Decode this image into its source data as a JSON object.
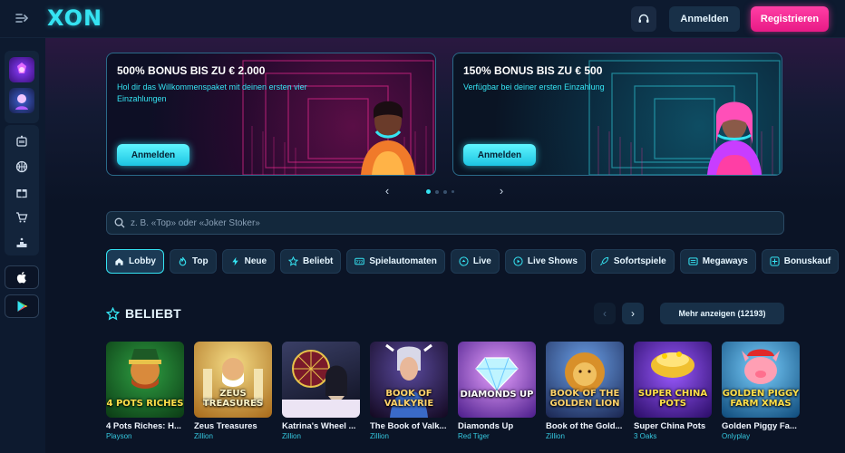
{
  "header": {
    "logo_text": "XON",
    "login_label": "Anmelden",
    "register_label": "Registrieren"
  },
  "banners": [
    {
      "title": "500% BONUS BIS ZU € 2.000",
      "text": "Hol dir das Willkommenspaket mit deinen ersten vier Einzahlungen",
      "button": "Anmelden",
      "accent": "#ff2e9a"
    },
    {
      "title": "150% BONUS BIS ZU € 500",
      "text": "Verfügbar bei deiner ersten Einzahlung",
      "button": "Anmelden",
      "accent": "#35e3f2"
    }
  ],
  "carousel": {
    "prev": "‹",
    "next": "›"
  },
  "search": {
    "placeholder": "z. B. «Top» oder «Joker Stoker»"
  },
  "categories": [
    {
      "label": "Lobby",
      "icon": "home-icon",
      "active": true
    },
    {
      "label": "Top",
      "icon": "flame-icon"
    },
    {
      "label": "Neue",
      "icon": "bolt-icon"
    },
    {
      "label": "Beliebt",
      "icon": "star-icon"
    },
    {
      "label": "Spielautomaten",
      "icon": "slot-777-icon"
    },
    {
      "label": "Live",
      "icon": "live-icon"
    },
    {
      "label": "Live Shows",
      "icon": "play-icon"
    },
    {
      "label": "Sofortspiele",
      "icon": "rocket-icon"
    },
    {
      "label": "Megaways",
      "icon": "megaways-icon"
    },
    {
      "label": "Bonuskauf",
      "icon": "bonus-buy-icon"
    }
  ],
  "section": {
    "title": "BELIEBT",
    "more_label": "Mehr anzeigen (12193)",
    "prev": "‹",
    "next": "›"
  },
  "games": [
    {
      "name": "4 Pots Riches: H...",
      "provider": "Playson",
      "thumb_text": "4 POTS RICHES",
      "color_a": "#1f7a2e",
      "color_b": "#0b3a14"
    },
    {
      "name": "Zeus Treasures",
      "provider": "Zillion",
      "thumb_text": "ZEUS TREASURES",
      "color_a": "#e0b34a",
      "color_b": "#7a4e12"
    },
    {
      "name": "Katrina's Wheel ...",
      "provider": "Zillion",
      "thumb_text": "",
      "color_a": "#2a2f4e",
      "color_b": "#0d0f1e"
    },
    {
      "name": "The Book of Valk...",
      "provider": "Zillion",
      "thumb_text": "BOOK OF VALKYRIE",
      "color_a": "#3a2a5e",
      "color_b": "#12081f"
    },
    {
      "name": "Diamonds Up",
      "provider": "Red Tiger",
      "thumb_text": "DIAMONDS UP",
      "color_a": "#d06fe8",
      "color_b": "#4a1c8a"
    },
    {
      "name": "Book of the Gold...",
      "provider": "Zillion",
      "thumb_text": "BOOK OF THE GOLDEN LION",
      "color_a": "#3f6ec4",
      "color_b": "#1a2550"
    },
    {
      "name": "Super China Pots",
      "provider": "3 Oaks",
      "thumb_text": "SUPER CHINA POTS",
      "color_a": "#6a2ad0",
      "color_b": "#2a0c66"
    },
    {
      "name": "Golden Piggy Fa...",
      "provider": "Onlyplay",
      "thumb_text": "GOLDEN PIGGY FARM XMAS",
      "color_a": "#2a9ad8",
      "color_b": "#0e4a7a"
    }
  ]
}
